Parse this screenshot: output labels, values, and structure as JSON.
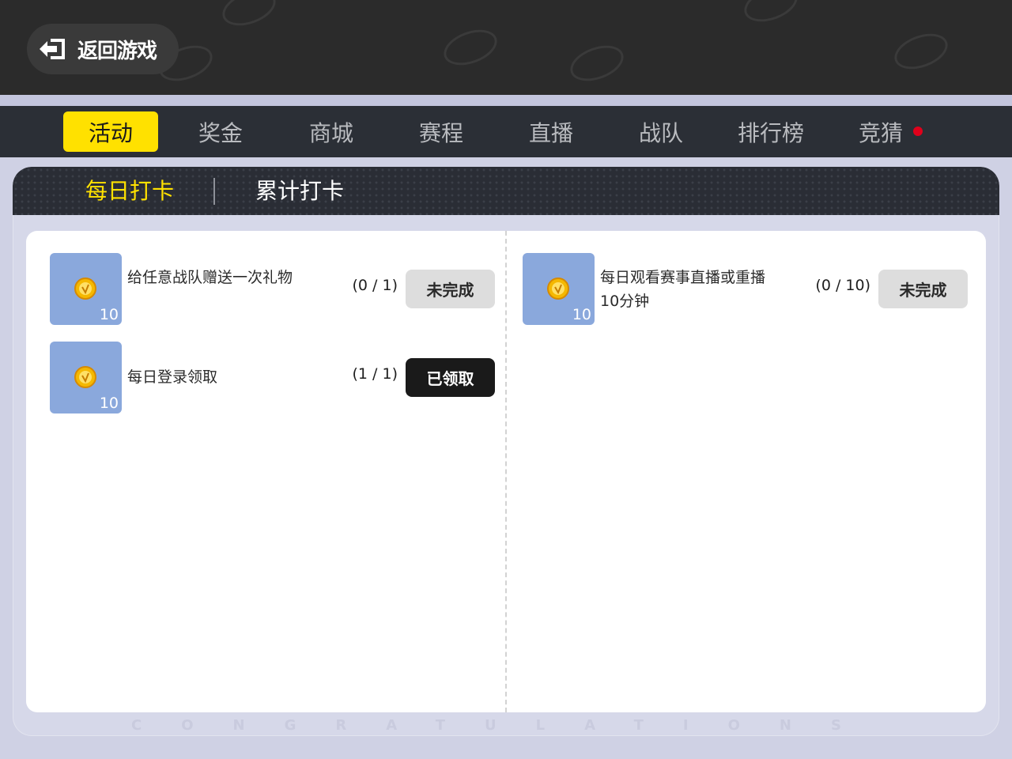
{
  "header": {
    "back_label": "返回游戏"
  },
  "nav": {
    "tabs": [
      {
        "label": "活动",
        "active": true
      },
      {
        "label": "奖金"
      },
      {
        "label": "商城"
      },
      {
        "label": "赛程"
      },
      {
        "label": "直播"
      },
      {
        "label": "战队"
      },
      {
        "label": "排行榜"
      },
      {
        "label": "竞猜",
        "notification_dot": true
      }
    ]
  },
  "subtabs": {
    "daily": "每日打卡",
    "cumulative": "累计打卡"
  },
  "tasks": [
    {
      "title": "给任意战队赠送一次礼物",
      "reward_qty": "10",
      "progress": "(0 / 1)",
      "status": "未完成"
    },
    {
      "title": "每日登录领取",
      "reward_qty": "10",
      "progress": "(1 / 1)",
      "status": "已领取"
    },
    {
      "title": "每日观看赛事直播或重播10分钟",
      "reward_qty": "10",
      "progress": "(0 / 10)",
      "status": "未完成"
    }
  ],
  "watermark": "CONGRATULATIONS",
  "colors": {
    "accent": "#ffe100",
    "nav_bg": "#2b2f36",
    "reward_bg": "#8aa8dc",
    "dot": "#e0001b"
  }
}
